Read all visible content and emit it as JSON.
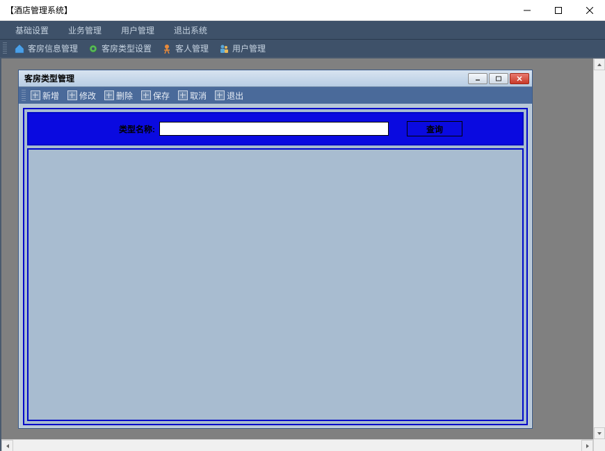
{
  "window": {
    "title": "【酒店管理系统】"
  },
  "menubar": {
    "items": [
      "基础设置",
      "业务管理",
      "用户管理",
      "退出系统"
    ]
  },
  "toolbar": {
    "items": [
      {
        "label": "客房信息管理",
        "icon": "house-icon",
        "color": "#4aa0e8"
      },
      {
        "label": "客房类型设置",
        "icon": "gear-icon",
        "color": "#58b858"
      },
      {
        "label": "客人管理",
        "icon": "person-icon",
        "color": "#e88a3a"
      },
      {
        "label": "用户管理",
        "icon": "users-icon",
        "color": "#5aa8d8"
      }
    ]
  },
  "child": {
    "title": "客房类型管理",
    "toolbar": [
      "新增",
      "修改",
      "删除",
      "保存",
      "取消",
      "退出"
    ],
    "search": {
      "label": "类型名称:",
      "value": "",
      "button": "查询"
    }
  }
}
